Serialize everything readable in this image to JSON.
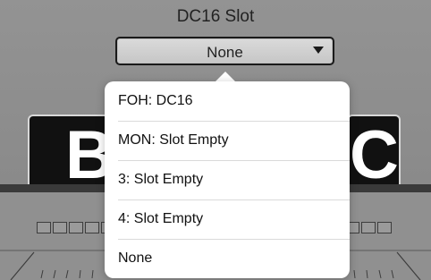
{
  "header": {
    "title": "DC16 Slot"
  },
  "select": {
    "value": "None"
  },
  "menu": {
    "items": [
      {
        "label": "FOH:  DC16"
      },
      {
        "label": "MON:  Slot Empty"
      },
      {
        "label": "3:  Slot Empty"
      },
      {
        "label": "4:  Slot Empty"
      },
      {
        "label": "None"
      }
    ]
  },
  "background": {
    "left_letter": "B",
    "right_letter": "C"
  }
}
